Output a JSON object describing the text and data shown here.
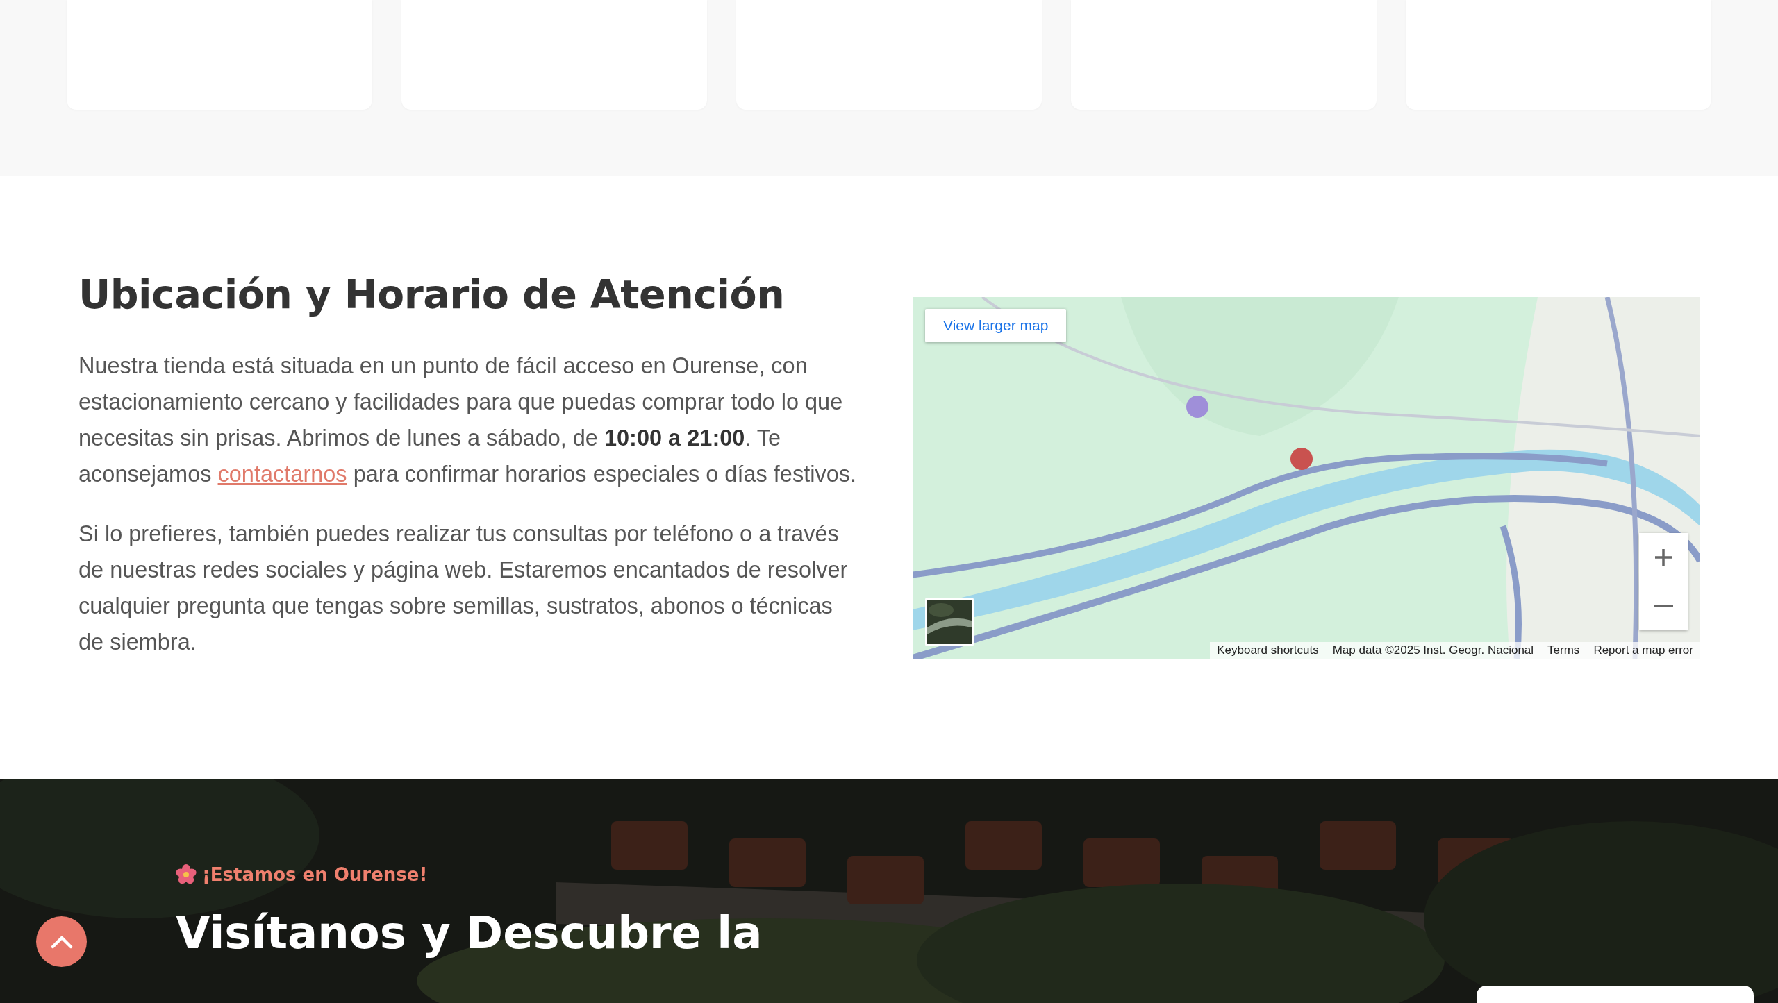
{
  "cards": [
    {
      "kind": "card"
    },
    {
      "kind": "card"
    },
    {
      "kind": "card"
    },
    {
      "kind": "card"
    },
    {
      "kind": "card"
    }
  ],
  "location": {
    "title": "Ubicación y Horario de Atención",
    "paragraph_1": {
      "before": "Nuestra tienda está situada en un punto de fácil acceso en Ourense, con estacionamiento cercano y facilidades para que puedas comprar todo lo que necesitas sin prisas. Abrimos de lunes a sábado, de **10:00 a 21:00**. Te aconsejamos ",
      "link": "contactarnos",
      "after": " para confirmar horarios especiales o días festivos."
    },
    "paragraph_2": "Si lo prefieres, también puedes realizar tus consultas por teléfono o a través de nuestras redes sociales y página web. Estaremos encantados de resolver cualquier pregunta que tengas sobre semillas, sustratos, abonos o técnicas de siembra.",
    "map": {
      "kind": "picture",
      "view_larger": "View larger map",
      "attribution": [
        "Keyboard shortcuts",
        "Map data ©2025 Inst. Geogr. Nacional",
        "Terms",
        "Report a map error"
      ]
    }
  },
  "visit": {
    "tagline": "¡Estamos en Ourense!",
    "heading": "Visítanos y Descubre la"
  }
}
